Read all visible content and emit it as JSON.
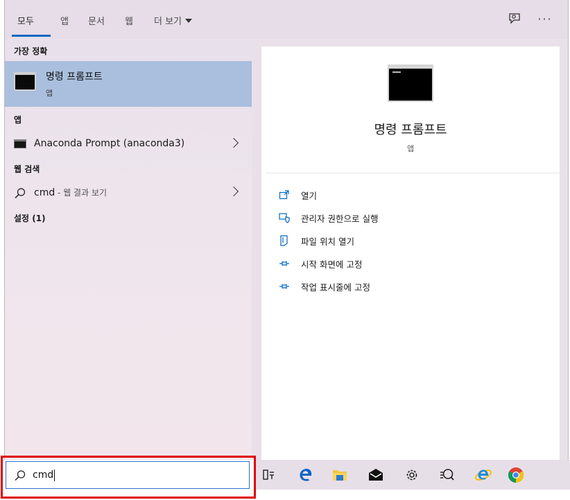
{
  "tabs": {
    "all": "모두",
    "apps": "앱",
    "documents": "문서",
    "web": "웹",
    "more": "더 보기",
    "options": "···"
  },
  "results": {
    "best_match_header": "가장 정확",
    "best_match": {
      "title": "명령 프롬프트",
      "subtitle": "앱"
    },
    "apps_header": "앱",
    "apps_item": "Anaconda Prompt (anaconda3)",
    "web_header": "웹 검색",
    "web_item_query": "cmd",
    "web_item_hint": " - 웹 결과 보기",
    "settings_header": "설정 (1)"
  },
  "detail": {
    "title": "명령 프롬프트",
    "subtitle": "앱",
    "actions": [
      {
        "label": "열기",
        "icon": "open-icon"
      },
      {
        "label": "관리자 권한으로 실행",
        "icon": "run-as-admin-icon"
      },
      {
        "label": "파일 위치 열기",
        "icon": "file-location-icon"
      },
      {
        "label": "시작 화면에 고정",
        "icon": "pin-icon"
      },
      {
        "label": "작업 표시줄에 고정",
        "icon": "pin-icon"
      }
    ]
  },
  "search": {
    "value": "cmd",
    "icon": "search-icon"
  },
  "taskbar": {
    "icons": [
      "task-view-icon",
      "edge-icon",
      "file-explorer-icon",
      "mail-icon",
      "settings-icon",
      "feedback-icon",
      "internet-explorer-icon",
      "chrome-icon"
    ]
  },
  "colors": {
    "accent": "#0067c0",
    "selection": "#a9bfdd",
    "highlight_box": "#e00000"
  }
}
